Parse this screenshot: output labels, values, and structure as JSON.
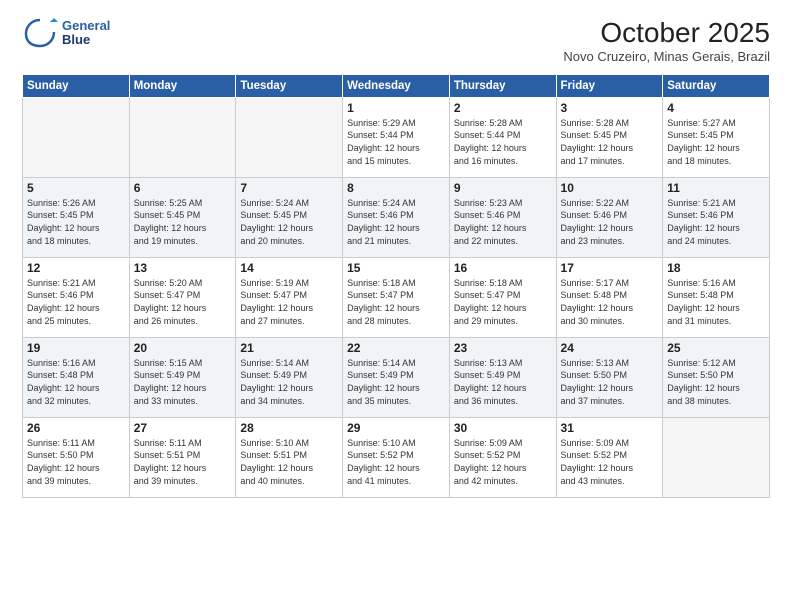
{
  "header": {
    "logo_line1": "General",
    "logo_line2": "Blue",
    "month_title": "October 2025",
    "location": "Novo Cruzeiro, Minas Gerais, Brazil"
  },
  "weekdays": [
    "Sunday",
    "Monday",
    "Tuesday",
    "Wednesday",
    "Thursday",
    "Friday",
    "Saturday"
  ],
  "weeks": [
    [
      {
        "day": "",
        "info": ""
      },
      {
        "day": "",
        "info": ""
      },
      {
        "day": "",
        "info": ""
      },
      {
        "day": "1",
        "info": "Sunrise: 5:29 AM\nSunset: 5:44 PM\nDaylight: 12 hours\nand 15 minutes."
      },
      {
        "day": "2",
        "info": "Sunrise: 5:28 AM\nSunset: 5:44 PM\nDaylight: 12 hours\nand 16 minutes."
      },
      {
        "day": "3",
        "info": "Sunrise: 5:28 AM\nSunset: 5:45 PM\nDaylight: 12 hours\nand 17 minutes."
      },
      {
        "day": "4",
        "info": "Sunrise: 5:27 AM\nSunset: 5:45 PM\nDaylight: 12 hours\nand 18 minutes."
      }
    ],
    [
      {
        "day": "5",
        "info": "Sunrise: 5:26 AM\nSunset: 5:45 PM\nDaylight: 12 hours\nand 18 minutes."
      },
      {
        "day": "6",
        "info": "Sunrise: 5:25 AM\nSunset: 5:45 PM\nDaylight: 12 hours\nand 19 minutes."
      },
      {
        "day": "7",
        "info": "Sunrise: 5:24 AM\nSunset: 5:45 PM\nDaylight: 12 hours\nand 20 minutes."
      },
      {
        "day": "8",
        "info": "Sunrise: 5:24 AM\nSunset: 5:46 PM\nDaylight: 12 hours\nand 21 minutes."
      },
      {
        "day": "9",
        "info": "Sunrise: 5:23 AM\nSunset: 5:46 PM\nDaylight: 12 hours\nand 22 minutes."
      },
      {
        "day": "10",
        "info": "Sunrise: 5:22 AM\nSunset: 5:46 PM\nDaylight: 12 hours\nand 23 minutes."
      },
      {
        "day": "11",
        "info": "Sunrise: 5:21 AM\nSunset: 5:46 PM\nDaylight: 12 hours\nand 24 minutes."
      }
    ],
    [
      {
        "day": "12",
        "info": "Sunrise: 5:21 AM\nSunset: 5:46 PM\nDaylight: 12 hours\nand 25 minutes."
      },
      {
        "day": "13",
        "info": "Sunrise: 5:20 AM\nSunset: 5:47 PM\nDaylight: 12 hours\nand 26 minutes."
      },
      {
        "day": "14",
        "info": "Sunrise: 5:19 AM\nSunset: 5:47 PM\nDaylight: 12 hours\nand 27 minutes."
      },
      {
        "day": "15",
        "info": "Sunrise: 5:18 AM\nSunset: 5:47 PM\nDaylight: 12 hours\nand 28 minutes."
      },
      {
        "day": "16",
        "info": "Sunrise: 5:18 AM\nSunset: 5:47 PM\nDaylight: 12 hours\nand 29 minutes."
      },
      {
        "day": "17",
        "info": "Sunrise: 5:17 AM\nSunset: 5:48 PM\nDaylight: 12 hours\nand 30 minutes."
      },
      {
        "day": "18",
        "info": "Sunrise: 5:16 AM\nSunset: 5:48 PM\nDaylight: 12 hours\nand 31 minutes."
      }
    ],
    [
      {
        "day": "19",
        "info": "Sunrise: 5:16 AM\nSunset: 5:48 PM\nDaylight: 12 hours\nand 32 minutes."
      },
      {
        "day": "20",
        "info": "Sunrise: 5:15 AM\nSunset: 5:49 PM\nDaylight: 12 hours\nand 33 minutes."
      },
      {
        "day": "21",
        "info": "Sunrise: 5:14 AM\nSunset: 5:49 PM\nDaylight: 12 hours\nand 34 minutes."
      },
      {
        "day": "22",
        "info": "Sunrise: 5:14 AM\nSunset: 5:49 PM\nDaylight: 12 hours\nand 35 minutes."
      },
      {
        "day": "23",
        "info": "Sunrise: 5:13 AM\nSunset: 5:49 PM\nDaylight: 12 hours\nand 36 minutes."
      },
      {
        "day": "24",
        "info": "Sunrise: 5:13 AM\nSunset: 5:50 PM\nDaylight: 12 hours\nand 37 minutes."
      },
      {
        "day": "25",
        "info": "Sunrise: 5:12 AM\nSunset: 5:50 PM\nDaylight: 12 hours\nand 38 minutes."
      }
    ],
    [
      {
        "day": "26",
        "info": "Sunrise: 5:11 AM\nSunset: 5:50 PM\nDaylight: 12 hours\nand 39 minutes."
      },
      {
        "day": "27",
        "info": "Sunrise: 5:11 AM\nSunset: 5:51 PM\nDaylight: 12 hours\nand 39 minutes."
      },
      {
        "day": "28",
        "info": "Sunrise: 5:10 AM\nSunset: 5:51 PM\nDaylight: 12 hours\nand 40 minutes."
      },
      {
        "day": "29",
        "info": "Sunrise: 5:10 AM\nSunset: 5:52 PM\nDaylight: 12 hours\nand 41 minutes."
      },
      {
        "day": "30",
        "info": "Sunrise: 5:09 AM\nSunset: 5:52 PM\nDaylight: 12 hours\nand 42 minutes."
      },
      {
        "day": "31",
        "info": "Sunrise: 5:09 AM\nSunset: 5:52 PM\nDaylight: 12 hours\nand 43 minutes."
      },
      {
        "day": "",
        "info": ""
      }
    ]
  ]
}
